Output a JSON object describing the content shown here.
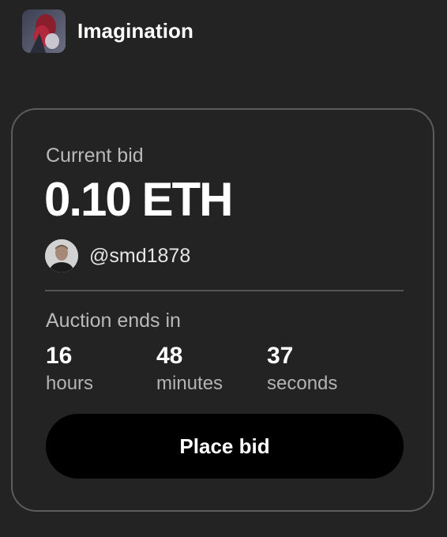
{
  "collection": {
    "name": "Imagination",
    "thumbnail_icon": "artwork-thumbnail"
  },
  "auction": {
    "current_bid_label": "Current bid",
    "current_bid_value": "0.10 ETH",
    "bidder": {
      "handle": "@smd1878",
      "avatar_icon": "user-avatar"
    },
    "ends_label": "Auction ends in",
    "countdown": [
      {
        "value": "16",
        "unit": "hours"
      },
      {
        "value": "48",
        "unit": "minutes"
      },
      {
        "value": "37",
        "unit": "seconds"
      }
    ],
    "button_label": "Place bid"
  },
  "colors": {
    "background": "#232323",
    "card_border": "#5c5c5c",
    "button": "#000000",
    "muted_text": "#b9b9b9"
  }
}
